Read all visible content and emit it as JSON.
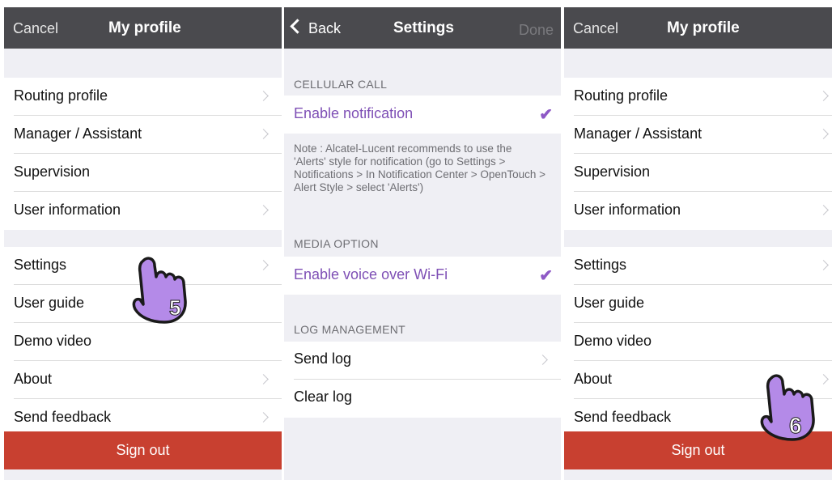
{
  "profile_left": {
    "nav": {
      "cancel": "Cancel",
      "title": "My profile"
    },
    "group1": [
      "Routing profile",
      "Manager / Assistant",
      "Supervision",
      "User information"
    ],
    "group2": [
      "Settings",
      "User guide",
      "Demo video",
      "About",
      "Send feedback"
    ],
    "sign_out": "Sign out",
    "step": "5"
  },
  "settings": {
    "nav": {
      "back": "Back",
      "title": "Settings",
      "done": "Done"
    },
    "cellular_header": "CELLULAR CALL",
    "enable_notification": "Enable notification",
    "note": "Note : Alcatel-Lucent recommends to use the 'Alerts' style for notification (go to Settings > Notifications > In Notification Center > OpenTouch > Alert Style > select 'Alerts')",
    "media_header": "MEDIA OPTION",
    "enable_voice_wifi": "Enable voice over Wi-Fi",
    "log_header": "LOG MANAGEMENT",
    "send_log": "Send log",
    "clear_log": "Clear log",
    "check_glyph": "✔"
  },
  "profile_right": {
    "nav": {
      "cancel": "Cancel",
      "title": "My profile"
    },
    "group1": [
      "Routing profile",
      "Manager / Assistant",
      "Supervision",
      "User information"
    ],
    "group2": [
      "Settings",
      "User guide",
      "Demo video",
      "About",
      "Send feedback"
    ],
    "sign_out": "Sign out",
    "step": "6"
  },
  "colors": {
    "navbar": "#4a4a4e",
    "sign_out": "#c84030",
    "accent_purple": "#8e59c6",
    "hand_fill": "#b48ae8"
  }
}
